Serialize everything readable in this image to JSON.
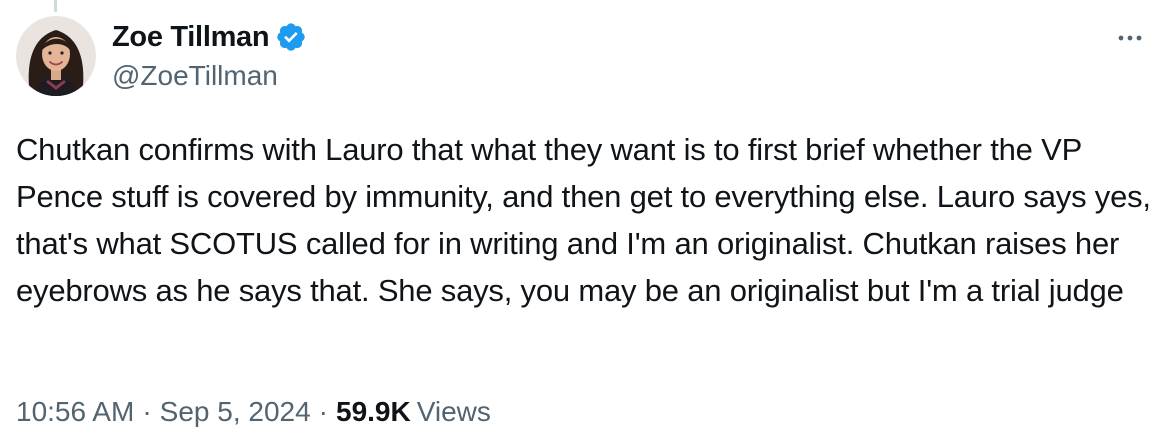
{
  "author": {
    "display_name": "Zoe Tillman",
    "handle": "@ZoeTillman",
    "verified": true
  },
  "icons": {
    "verified": "verified-badge-icon",
    "more": "more-options-icon"
  },
  "tweet": {
    "text": "Chutkan confirms with Lauro that what they want is to first brief whether the VP Pence stuff is covered by immunity, and then get to everything else. Lauro says yes, that's what SCOTUS called for in writing and I'm an originalist. Chutkan raises her eyebrows as he says that. She says, you may be an originalist but I'm a trial judge"
  },
  "meta": {
    "time": "10:56 AM",
    "separator": "·",
    "date": "Sep 5, 2024",
    "views_count": "59.9K",
    "views_label": "Views"
  },
  "colors": {
    "text": "#0f1419",
    "secondary": "#536471",
    "verified_blue": "#1d9bf0",
    "thread_line": "#cfd9de"
  }
}
